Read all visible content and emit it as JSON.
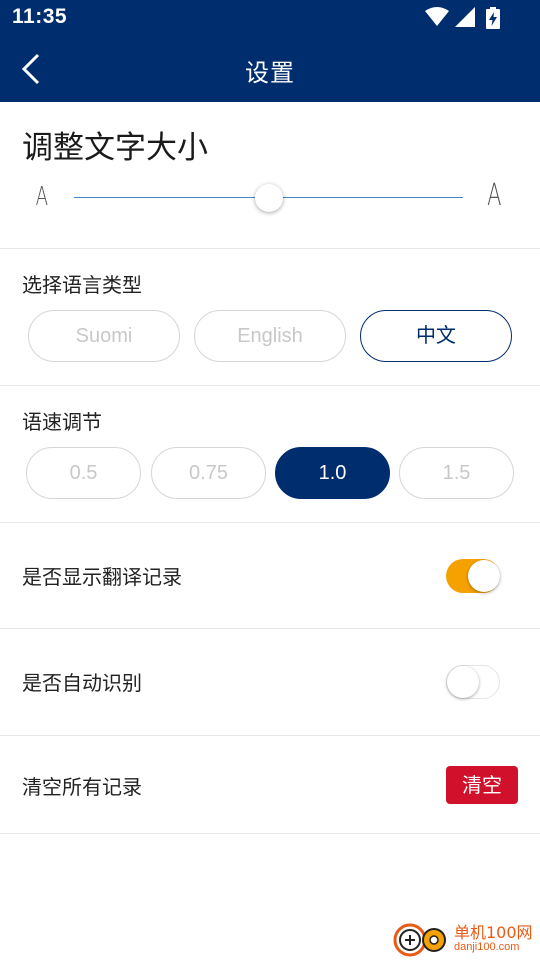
{
  "status_bar": {
    "time": "11:35",
    "icons": [
      "wifi-icon",
      "cell-signal-icon",
      "battery-charging-icon"
    ]
  },
  "header": {
    "title": "设置",
    "back_icon": "chevron-left-icon"
  },
  "font_size": {
    "title": "调整文字大小",
    "small_glyph": "A",
    "large_glyph": "A",
    "slider_value": 0.5
  },
  "language": {
    "label": "选择语言类型",
    "options": [
      "Suomi",
      "English",
      "中文"
    ],
    "selected": "中文"
  },
  "speech_rate": {
    "label": "语速调节",
    "options": [
      "0.5",
      "0.75",
      "1.0",
      "1.5"
    ],
    "selected": "1.0"
  },
  "show_history": {
    "label": "是否显示翻译记录",
    "enabled": true
  },
  "auto_detect": {
    "label": "是否自动识别",
    "enabled": false
  },
  "clear_records": {
    "label": "清空所有记录",
    "button": "清空"
  },
  "watermark": {
    "text": "单机100网",
    "url": "danji100.com"
  },
  "colors": {
    "primary": "#002d6e",
    "toggle_on": "#f5a100",
    "danger": "#d1112b",
    "slider": "#3f86cc"
  }
}
